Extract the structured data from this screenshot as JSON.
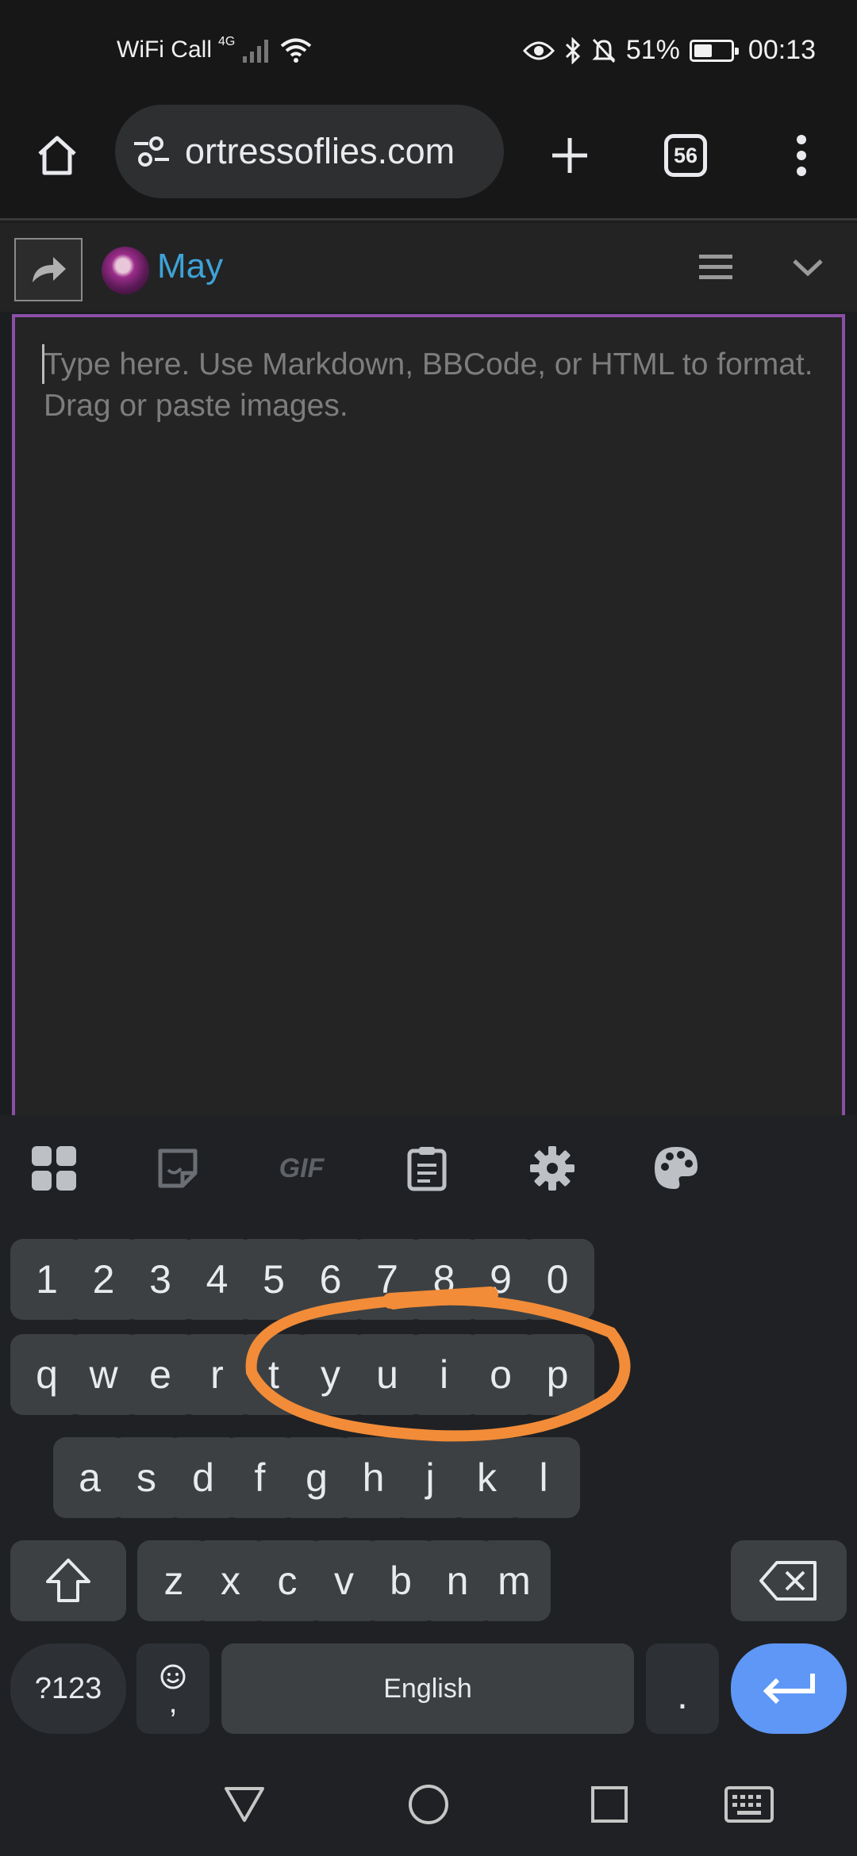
{
  "status_bar": {
    "wifi_call": "WiFi Call",
    "network": "4G",
    "battery": "51%",
    "battery_level": 0.51,
    "time": "00:13"
  },
  "browser": {
    "url": "ortressoflies.com",
    "tab_count": "56"
  },
  "reply": {
    "username": "May",
    "username_color": "#3ea3d8",
    "editor_border_color": "#8a4fa6",
    "placeholder": "Type here. Use Markdown, BBCode, or HTML to format. Drag or paste images."
  },
  "keyboard": {
    "toolbar": [
      "apps-grid-icon",
      "sticker-icon",
      "gif-icon",
      "clipboard-icon",
      "settings-gear-icon",
      "palette-icon"
    ],
    "gif_label": "GIF",
    "number_row": [
      "1",
      "2",
      "3",
      "4",
      "5",
      "6",
      "7",
      "8",
      "9",
      "0"
    ],
    "row1": [
      "q",
      "w",
      "e",
      "r",
      "t",
      "y",
      "u",
      "i",
      "o",
      "p"
    ],
    "row2": [
      "a",
      "s",
      "d",
      "f",
      "g",
      "h",
      "j",
      "k",
      "l"
    ],
    "row3": [
      "z",
      "x",
      "c",
      "v",
      "b",
      "n",
      "m"
    ],
    "symbols_label": "?123",
    "comma_label": ",",
    "space_label": "English",
    "period_label": ".",
    "accent_color": "#5e97f6"
  },
  "annotation": {
    "type": "hand-drawn-circle",
    "color": "#f28c38",
    "encircles": [
      "r",
      "t",
      "y",
      "u"
    ]
  }
}
